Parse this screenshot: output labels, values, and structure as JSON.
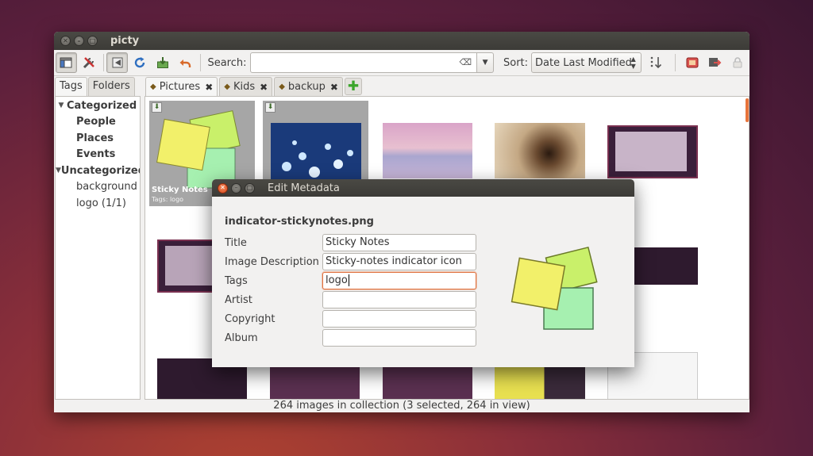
{
  "window": {
    "title": "picty"
  },
  "toolbar": {
    "search_label": "Search:",
    "search_value": "",
    "sort_label": "Sort:",
    "sort_value": "Date Last Modified"
  },
  "sidebar": {
    "tabs": [
      "Tags",
      "Folders"
    ],
    "tree": [
      {
        "label": "Categorized",
        "level": 0,
        "bold": true,
        "expanded": true
      },
      {
        "label": "People",
        "level": 1,
        "bold": true
      },
      {
        "label": "Places",
        "level": 1,
        "bold": true
      },
      {
        "label": "Events",
        "level": 1,
        "bold": true
      },
      {
        "label": "Uncategorized",
        "level": 0,
        "bold": true,
        "expanded": true
      },
      {
        "label": "background (",
        "level": 1,
        "bold": false
      },
      {
        "label": "logo (1/1)",
        "level": 1,
        "bold": false
      }
    ]
  },
  "tabs": [
    {
      "label": "Pictures",
      "active": true
    },
    {
      "label": "Kids",
      "active": false
    },
    {
      "label": "backup",
      "active": false
    }
  ],
  "thumbnail": {
    "caption": "Sticky Notes",
    "tags": "Tags: logo"
  },
  "status": "264 images in collection (3 selected, 264 in view)",
  "dialog": {
    "title": "Edit Metadata",
    "filename": "indicator-stickynotes.png",
    "fields": [
      {
        "label": "Title",
        "value": "Sticky Notes"
      },
      {
        "label": "Image Description",
        "value": "Sticky-notes indicator icon"
      },
      {
        "label": "Tags",
        "value": "logo"
      },
      {
        "label": "Artist",
        "value": ""
      },
      {
        "label": "Copyright",
        "value": ""
      },
      {
        "label": "Album",
        "value": ""
      }
    ]
  },
  "colors": {
    "accent": "#e0723f",
    "titlebar": "#3c3b37",
    "sticky_yellow": "#f2f06a",
    "sticky_lime": "#c9f06a",
    "sticky_green": "#a6f0b0"
  }
}
